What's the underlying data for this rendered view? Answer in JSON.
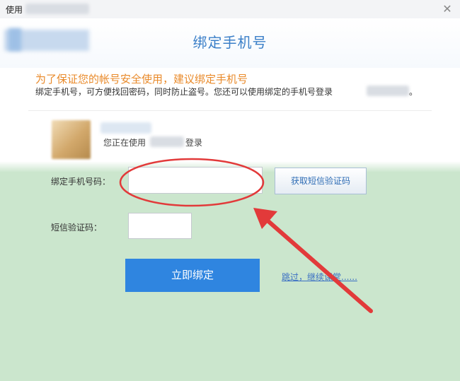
{
  "window": {
    "title": "使用",
    "close_symbol": "✕"
  },
  "dialog": {
    "title": "绑定手机号",
    "warning": "为了保证您的帐号安全使用，建议绑定手机号",
    "description": "绑定手机号，可方便找回密码，同时防止盗号。您还可以使用绑定的手机号登录",
    "description_tail": "。"
  },
  "user": {
    "login_prefix": "您正在使用",
    "login_suffix": "登录"
  },
  "form": {
    "phone_label": "绑定手机号码：",
    "phone_value": "",
    "sms_label": "短信验证码：",
    "sms_value": "",
    "get_code_label": "获取短信验证码",
    "bind_label": "立即绑定",
    "skip_label": "跳过，继续课堂......"
  },
  "colors": {
    "accent": "#2f85e0",
    "title": "#3b7fc8",
    "warning": "#e98a2a",
    "form_background": "#cbe6cd",
    "annotation": "#e23a3a"
  },
  "icons": {
    "close": "close-icon",
    "annotation_arrow": "arrow-icon"
  }
}
